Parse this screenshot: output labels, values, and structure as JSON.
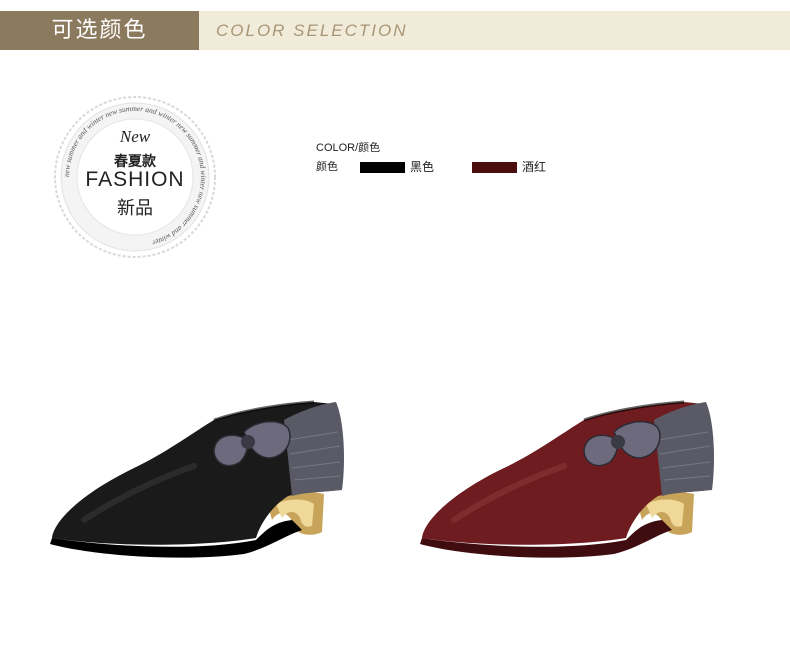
{
  "header": {
    "cn_title": "可选颜色",
    "en_title": "COLOR SELECTION"
  },
  "badge": {
    "new_text": "New",
    "season": "春夏款",
    "fashion": "FASHION",
    "xinpin": "新品",
    "ring_text": "new summer and winter  new summer and winter  new summer and winter  new summer and winter"
  },
  "colors": {
    "title": "COLOR/颜色",
    "row_label": "颜色",
    "options": [
      {
        "name": "黑色",
        "hex": "#000000"
      },
      {
        "name": "酒红",
        "hex": "#4a0e0e"
      }
    ]
  },
  "products": [
    {
      "name": "black-shoe",
      "upper": "#1a1a1a",
      "shade": "#000000",
      "highlight": "#4d4d4d"
    },
    {
      "name": "wine-shoe",
      "upper": "#6e1c20",
      "shade": "#3f0c10",
      "highlight": "#a04a4a"
    }
  ]
}
